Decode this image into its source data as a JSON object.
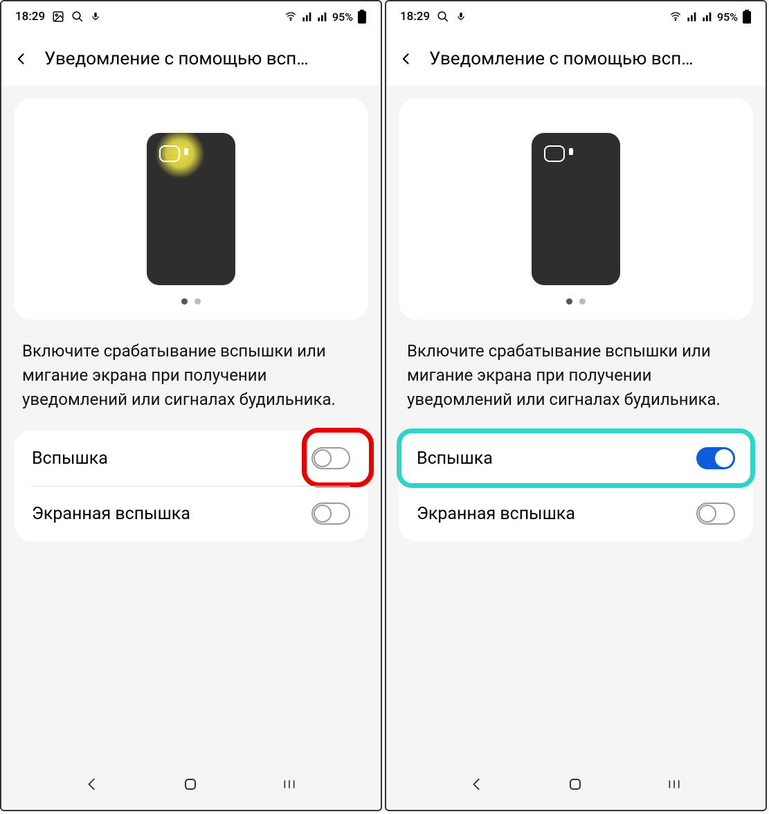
{
  "screens": [
    {
      "statusbar": {
        "time": "18:29",
        "battery": "95%",
        "icons_left": [
          "image",
          "search",
          "voice"
        ]
      },
      "header": {
        "title": "Уведомление с помощью всп…"
      },
      "description": "Включите срабатывание вспышки или мигание экрана при получении уведомлений или сигналах будильника.",
      "illustration": {
        "flash_on": true
      },
      "settings": [
        {
          "label": "Вспышка",
          "on": false
        },
        {
          "label": "Экранная вспышка",
          "on": false
        }
      ],
      "highlight": {
        "type": "red",
        "target": "toggle-0"
      }
    },
    {
      "statusbar": {
        "time": "18:29",
        "battery": "95%",
        "icons_left": [
          "search",
          "voice"
        ]
      },
      "header": {
        "title": "Уведомление с помощью всп…"
      },
      "description": "Включите срабатывание вспышки или мигание экрана при получении уведомлений или сигналах будильника.",
      "illustration": {
        "flash_on": false
      },
      "settings": [
        {
          "label": "Вспышка",
          "on": true
        },
        {
          "label": "Экранная вспышка",
          "on": false
        }
      ],
      "highlight": {
        "type": "teal",
        "target": "row-0"
      }
    }
  ]
}
